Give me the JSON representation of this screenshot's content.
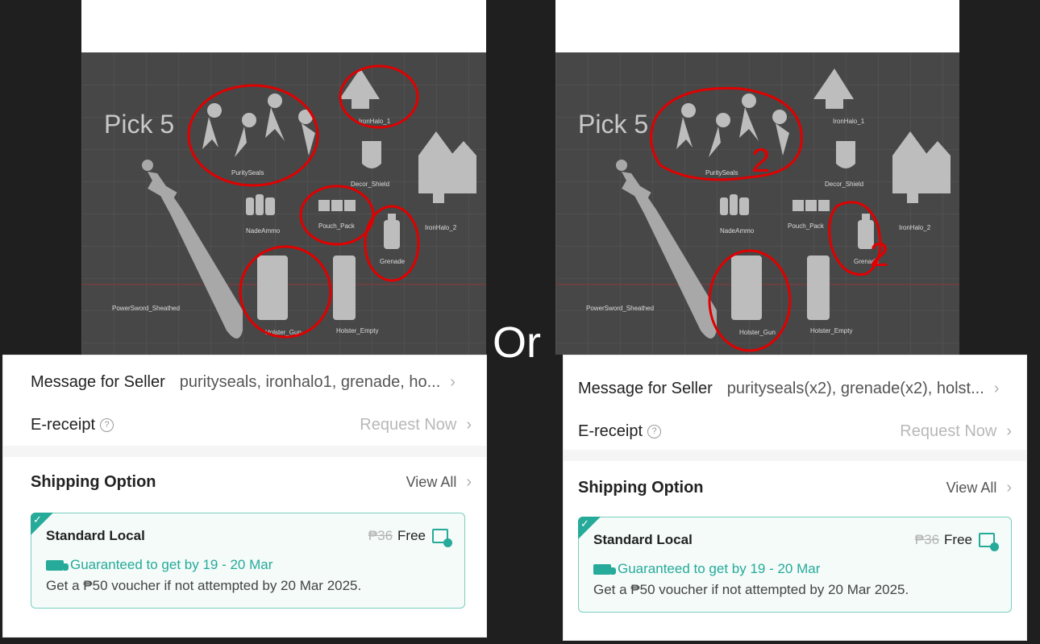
{
  "separator": "Or",
  "left": {
    "viewport": {
      "pick_label": "Pick 5",
      "labels": {
        "purity_seals": "PuritySeals",
        "iron_halo_1": "IronHalo_1",
        "decor_shield": "Decor_Shield",
        "iron_halo_2": "IronHalo_2",
        "nade_ammo": "NadeAmmo",
        "pouch_pack": "Pouch_Pack",
        "grenade": "Grenade",
        "power_sword": "PowerSword_Sheathed",
        "holster_gun": "Holster_Gun",
        "holster_empty": "Holster_Empty"
      }
    },
    "message": {
      "label": "Message for Seller",
      "value": "purityseals, ironhalo1, grenade, ho..."
    },
    "ereceipt": {
      "label": "E-receipt",
      "action": "Request Now"
    },
    "shipping": {
      "label": "Shipping Option",
      "view_all": "View All",
      "card": {
        "title": "Standard Local",
        "old_price": "₱36",
        "price": "Free",
        "guarantee": "Guaranteed to get by 19 - 20 Mar",
        "note": "Get a ₱50 voucher if not attempted by 20 Mar 2025."
      }
    }
  },
  "right": {
    "viewport": {
      "pick_label": "Pick 5",
      "annotation_count_seals": "2",
      "annotation_count_grenade": "2",
      "labels": {
        "purity_seals": "PuritySeals",
        "iron_halo_1": "IronHalo_1",
        "decor_shield": "Decor_Shield",
        "iron_halo_2": "IronHalo_2",
        "nade_ammo": "NadeAmmo",
        "pouch_pack": "Pouch_Pack",
        "grenade": "Grenade",
        "power_sword": "PowerSword_Sheathed",
        "holster_gun": "Holster_Gun",
        "holster_empty": "Holster_Empty"
      }
    },
    "message": {
      "label": "Message for Seller",
      "value": "purityseals(x2), grenade(x2), holst..."
    },
    "ereceipt": {
      "label": "E-receipt",
      "action": "Request Now"
    },
    "shipping": {
      "label": "Shipping Option",
      "view_all": "View All",
      "card": {
        "title": "Standard Local",
        "old_price": "₱36",
        "price": "Free",
        "guarantee": "Guaranteed to get by 19 - 20 Mar",
        "note": "Get a ₱50 voucher if not attempted by 20 Mar 2025."
      }
    }
  },
  "colors": {
    "accent": "#26aa99",
    "annotation": "#e00000",
    "viewport_bg": "#474747"
  },
  "icons": [
    "help-circle-icon",
    "chevron-right-icon",
    "truck-icon",
    "voucher-icon",
    "check-icon"
  ]
}
